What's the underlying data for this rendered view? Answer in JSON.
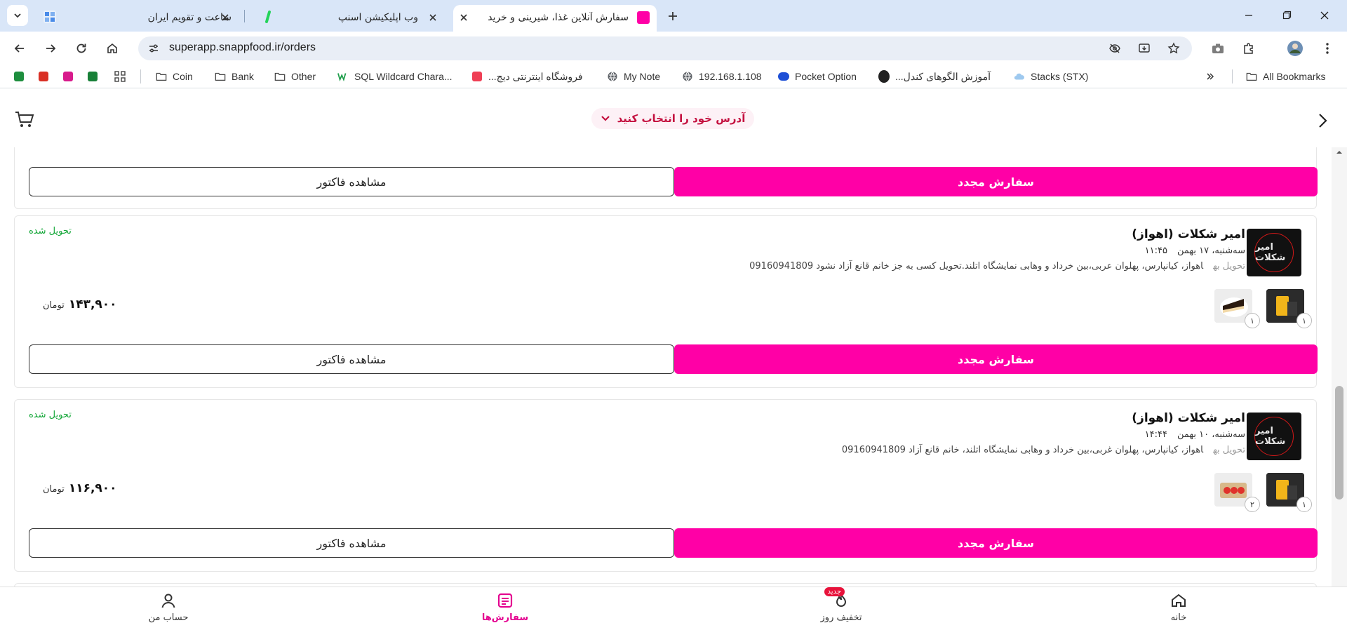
{
  "browser": {
    "tabs": [
      {
        "title": "ساعت و تقویم ایران",
        "active": false
      },
      {
        "title": "وب اپلیکیشن اسنپ",
        "active": false
      },
      {
        "title": "سفارش آنلاین غذا، شیرینی و خرید",
        "active": true
      }
    ],
    "url": "superapp.snappfood.ir/orders",
    "bookmarks": {
      "coin": "Coin",
      "bank": "Bank",
      "other": "Other",
      "sql": "SQL Wildcard Chara...",
      "shop": "فروشگاه اینترنتی دیج...",
      "mynote": "My Note",
      "ip": "192.168.1.108",
      "pocket": "Pocket Option",
      "learn": "آموزش الگوهای کندل...",
      "stacks": "Stacks (STX)",
      "all": "All Bookmarks"
    },
    "colors": {
      "chrome": "#d9e6f8",
      "omnibox": "#e9eef6"
    }
  },
  "header": {
    "address_prompt": "آدرس خود را انتخاب کنید"
  },
  "orders": {
    "top": {
      "reorder": "سفارش مجدد",
      "invoice": "مشاهده فاکتور"
    },
    "items": [
      {
        "status": "تحویل شده",
        "vendor": "امیر شکلات (اهواز)",
        "logo_text": "امیر شکلات",
        "date": "سه‌شنبه، ۱۷ بهمن",
        "time": "۱۱:۴۵",
        "delivery_label": "تحویل به",
        "address": "اهواز، کیانپارس، پهلوان عربی،بین خرداد و وهابی نمایشگاه اتلند.تحویل کسی به جز خانم قانع آزاد نشود 09160941809",
        "price": "۱۴۳,۹۰۰",
        "currency": "تومان",
        "thumbs": [
          {
            "qty": "۱"
          },
          {
            "qty": "۱"
          }
        ],
        "reorder": "سفارش مجدد",
        "invoice": "مشاهده فاکتور"
      },
      {
        "status": "تحویل شده",
        "vendor": "امیر شکلات (اهواز)",
        "logo_text": "امیر شکلات",
        "date": "سه‌شنبه، ۱۰ بهمن",
        "time": "۱۴:۴۴",
        "delivery_label": "تحویل به",
        "address": "اهواز، کیانپارس، پهلوان غربی،بین خرداد و وهابی نمایشگاه اتلند، خانم قانع آزاد 09160941809",
        "price": "۱۱۶,۹۰۰",
        "currency": "تومان",
        "thumbs": [
          {
            "qty": "۱"
          },
          {
            "qty": "۲"
          }
        ],
        "reorder": "سفارش مجدد",
        "invoice": "مشاهده فاکتور"
      }
    ]
  },
  "nav": {
    "home": "خانه",
    "offers": "تخفیف روز",
    "offers_badge": "جدید",
    "orders": "سفارش‌ها",
    "account": "حساب من"
  },
  "colors": {
    "brand": "#ff00a6",
    "status_green": "#12a637",
    "nav_active": "#e4008f"
  }
}
